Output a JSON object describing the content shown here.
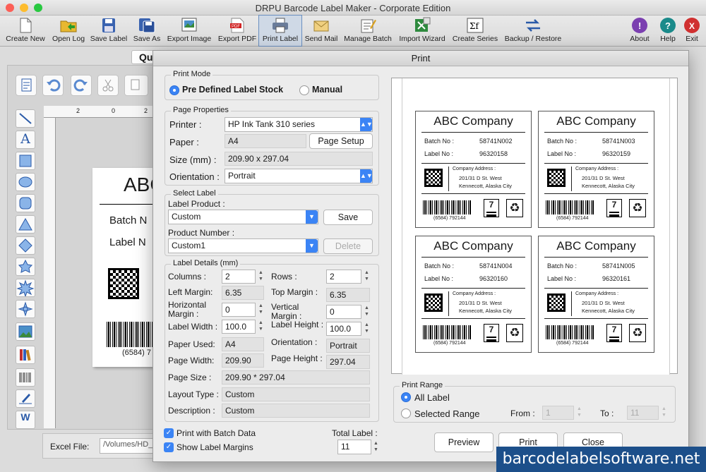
{
  "app": {
    "title": "DRPU Barcode Label Maker - Corporate Edition"
  },
  "toolbar": [
    {
      "label": "Create New",
      "icon": "new-file-icon"
    },
    {
      "label": "Open Log",
      "icon": "open-folder-icon"
    },
    {
      "label": "Save Label",
      "icon": "save-icon"
    },
    {
      "label": "Save As",
      "icon": "save-as-icon"
    },
    {
      "label": "Export Image",
      "icon": "export-image-icon"
    },
    {
      "label": "Export PDF",
      "icon": "export-pdf-icon"
    },
    {
      "label": "Print Label",
      "icon": "printer-icon"
    },
    {
      "label": "Send Mail",
      "icon": "mail-icon"
    },
    {
      "label": "Manage Batch",
      "icon": "batch-icon"
    },
    {
      "label": "Import Wizard",
      "icon": "import-icon"
    },
    {
      "label": "Create Series",
      "icon": "series-icon"
    },
    {
      "label": "Backup / Restore",
      "icon": "backup-icon"
    },
    {
      "label": "About",
      "icon": "about-icon"
    },
    {
      "label": "Help",
      "icon": "help-icon"
    },
    {
      "label": "Exit",
      "icon": "exit-icon"
    }
  ],
  "workspace": {
    "tab_partial": "Qu",
    "canvas_company": "ABC",
    "canvas_batch": "Batch N",
    "canvas_label": "Label N",
    "canvas_barcode_num": "(6584) 7",
    "ruler_ticks": [
      "2",
      "0",
      "2"
    ],
    "excel_file_label": "Excel File:",
    "excel_file_value": "/Volumes/HD_"
  },
  "dialog": {
    "title": "Print",
    "print_mode": {
      "legend": "Print Mode",
      "option_predefined": "Pre Defined Label Stock",
      "option_manual": "Manual"
    },
    "page_properties": {
      "legend": "Page Properties",
      "printer_label": "Printer :",
      "printer_value": "HP Ink Tank 310 series",
      "paper_label": "Paper :",
      "paper_value": "A4",
      "page_setup_button": "Page Setup",
      "size_label": "Size (mm) :",
      "size_value": "209.90 x 297.04",
      "orientation_label": "Orientation :",
      "orientation_value": "Portrait"
    },
    "select_label": {
      "legend": "Select Label",
      "product_label": "Label Product :",
      "product_value": "Custom",
      "save_button": "Save",
      "number_label": "Product Number :",
      "number_value": "Custom1",
      "delete_button": "Delete"
    },
    "label_details": {
      "legend": "Label Details (mm)",
      "columns_label": "Columns :",
      "columns_value": "2",
      "rows_label": "Rows :",
      "rows_value": "2",
      "left_margin_label": "Left Margin:",
      "left_margin_value": "6.35",
      "top_margin_label": "Top Margin :",
      "top_margin_value": "6.35",
      "hmargin_label_1": "Horizontal",
      "hmargin_label_2": "Margin :",
      "hmargin_value": "0",
      "vmargin_label_1": "Vertical",
      "vmargin_label_2": "Margin :",
      "vmargin_value": "0",
      "width_label": "Label Width :",
      "width_value": "100.0",
      "height_label": "Label Height :",
      "height_value": "100.0",
      "paper_used_label": "Paper Used:",
      "paper_used_value": "A4",
      "orientation_label": "Orientation :",
      "orientation_value": "Portrait",
      "page_width_label": "Page Width:",
      "page_width_value": "209.90",
      "page_height_label": "Page Height :",
      "page_height_value": "297.04",
      "page_size_label": "Page Size :",
      "page_size_value": "209.90 * 297.04",
      "layout_type_label": "Layout Type :",
      "layout_type_value": "Custom",
      "description_label": "Description :",
      "description_value": "Custom"
    },
    "print_batch_label": "Print with Batch Data",
    "show_margins_label": "Show Label Margins",
    "total_label_label": "Total Label :",
    "total_label_value": "11",
    "print_range": {
      "legend": "Print Range",
      "all_label": "All Label",
      "selected_range": "Selected Range",
      "from_label": "From :",
      "from_value": "1",
      "to_label": "To :",
      "to_value": "11"
    },
    "buttons": {
      "preview": "Preview",
      "print": "Print",
      "close": "Close"
    }
  },
  "preview_labels": [
    {
      "company": "ABC Company",
      "batch_key": "Batch No :",
      "batch": "58741N002",
      "label_key": "Label No :",
      "label": "96320158",
      "addr_key": "Company Address :",
      "addr1": "201/31 D St. West",
      "addr2": "Kennecott, Alaska City",
      "barcode_num": "(6584) 792144",
      "box_num": "7"
    },
    {
      "company": "ABC Company",
      "batch_key": "Batch No :",
      "batch": "58741N003",
      "label_key": "Label No :",
      "label": "96320159",
      "addr_key": "Company Address :",
      "addr1": "201/31 D St. West",
      "addr2": "Kennecott, Alaska City",
      "barcode_num": "(6584) 792144",
      "box_num": "7"
    },
    {
      "company": "ABC Company",
      "batch_key": "Batch No :",
      "batch": "58741N004",
      "label_key": "Label No :",
      "label": "96320160",
      "addr_key": "Company Address :",
      "addr1": "201/31 D St. West",
      "addr2": "Kennecott, Alaska City",
      "barcode_num": "(6584) 792144",
      "box_num": "7"
    },
    {
      "company": "ABC Company",
      "batch_key": "Batch No :",
      "batch": "58741N005",
      "label_key": "Label No :",
      "label": "96320161",
      "addr_key": "Company Address :",
      "addr1": "201/31 D St. West",
      "addr2": "Kennecott, Alaska City",
      "barcode_num": "(6584) 792144",
      "box_num": "7"
    }
  ],
  "watermark": "barcodelabelsoftware.net",
  "colors": {
    "accent": "#3b84f5",
    "watermark_bg": "#1c4f8a",
    "about": "#7b3fb0",
    "help": "#1a8a8a",
    "exit": "#d03030"
  }
}
